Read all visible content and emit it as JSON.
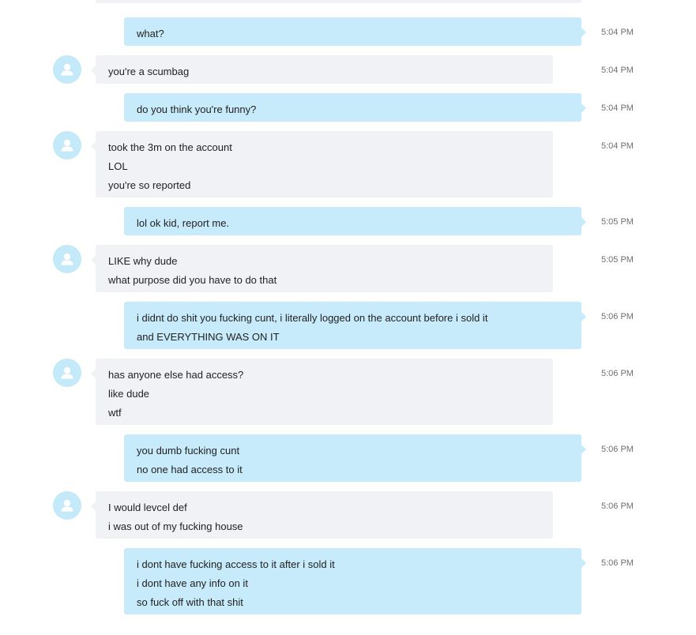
{
  "conversation": {
    "messages": [
      {
        "dir": "out",
        "lines": [
          "what?"
        ],
        "time": "5:04 PM"
      },
      {
        "dir": "in",
        "lines": [
          "you're a scumbag"
        ],
        "time": "5:04 PM"
      },
      {
        "dir": "out",
        "lines": [
          "do you think you're funny?"
        ],
        "time": "5:04 PM"
      },
      {
        "dir": "in",
        "lines": [
          "took the 3m on the account",
          "LOL",
          "you're so reported"
        ],
        "time": "5:04 PM"
      },
      {
        "dir": "out",
        "lines": [
          "lol ok kid, report me."
        ],
        "time": "5:05 PM"
      },
      {
        "dir": "in",
        "lines": [
          "LIKE why dude",
          "what purpose did you have to do that"
        ],
        "time": "5:05 PM"
      },
      {
        "dir": "out",
        "lines": [
          "i didnt do shit you fucking cunt, i literally logged on the account before i sold it",
          "and EVERYTHING WAS ON IT"
        ],
        "time": "5:06 PM"
      },
      {
        "dir": "in",
        "lines": [
          "has anyone else had access?",
          "like dude",
          "wtf"
        ],
        "time": "5:06 PM"
      },
      {
        "dir": "out",
        "lines": [
          "you dumb fucking cunt",
          "no one had access to it"
        ],
        "time": "5:06 PM"
      },
      {
        "dir": "in",
        "lines": [
          "I would levcel def",
          "i was out of my fucking house"
        ],
        "time": "5:06 PM"
      },
      {
        "dir": "out",
        "lines": [
          "i dont have fucking access to it after i sold it",
          "i dont have any info on it",
          "so fuck off with that shit"
        ],
        "time": "5:06 PM"
      }
    ]
  },
  "icons": {
    "avatar": "default-user-avatar-icon"
  },
  "colors": {
    "outgoing_bubble": "#c7ebfa",
    "incoming_bubble": "#f1f2f6",
    "avatar_bg": "#c4e9f9",
    "timestamp": "#6e6e73"
  }
}
